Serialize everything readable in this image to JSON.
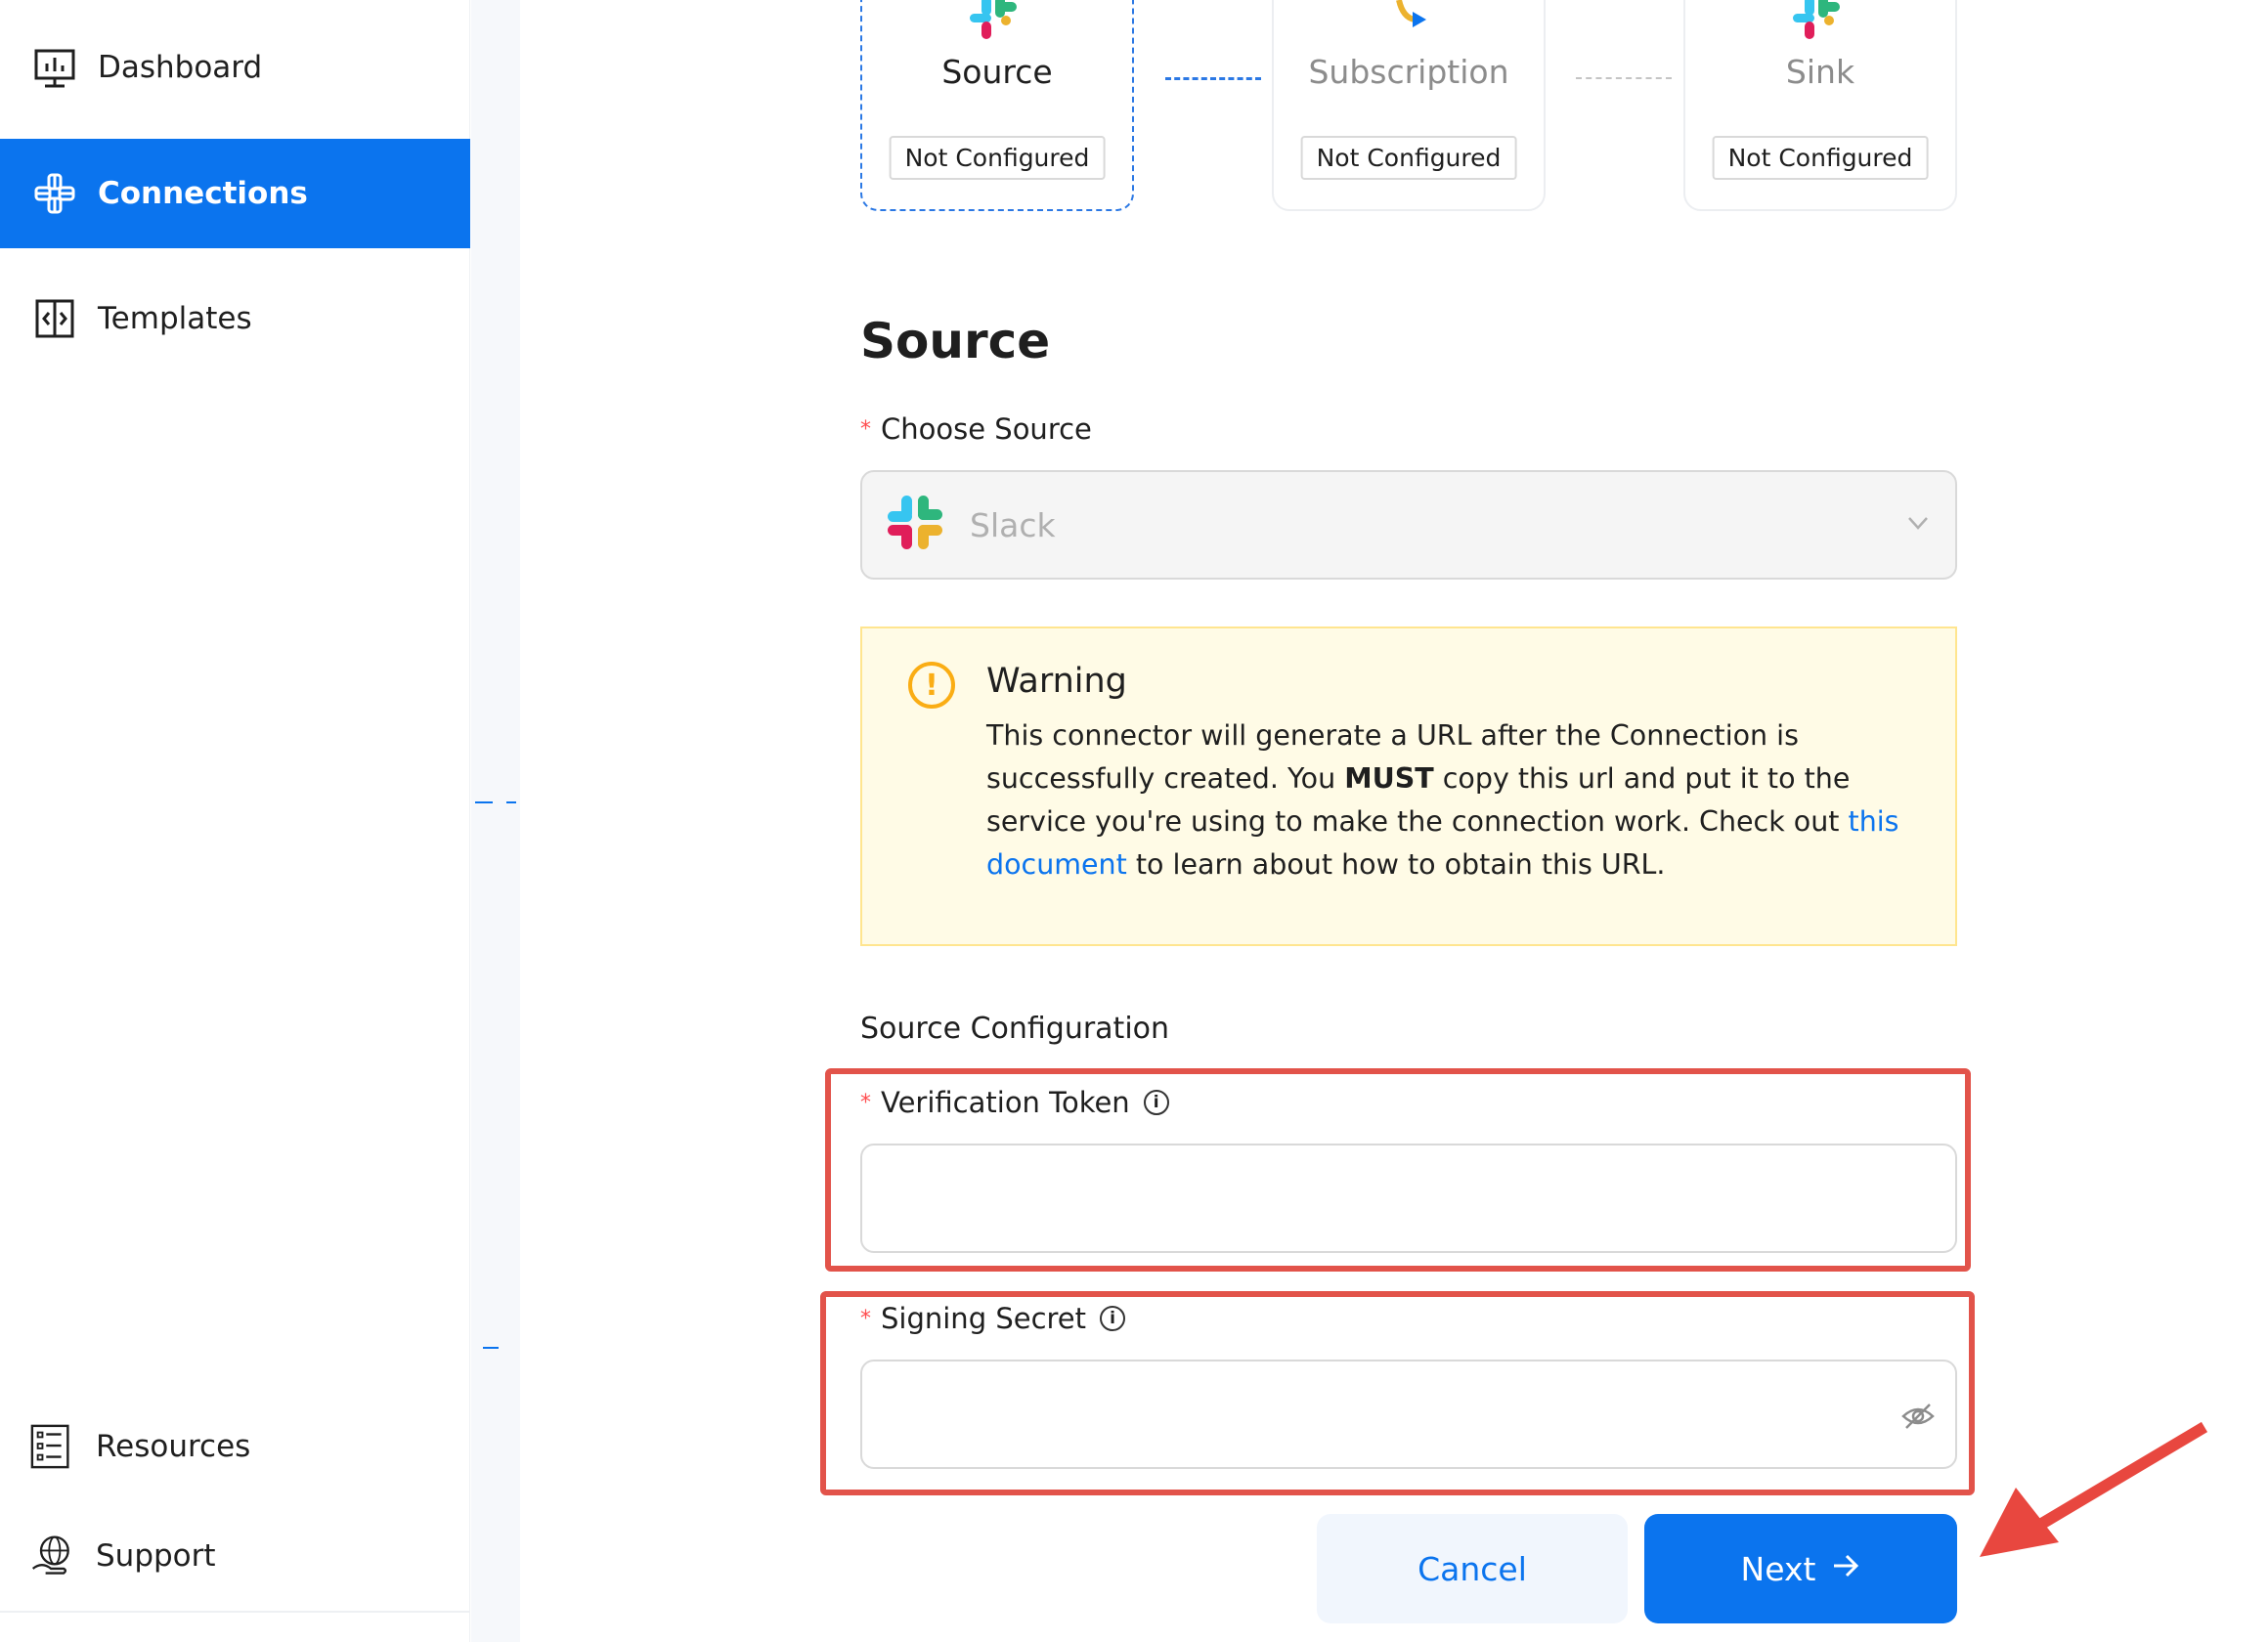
{
  "sidebar": {
    "items": [
      {
        "label": "Dashboard",
        "icon": "dashboard-icon"
      },
      {
        "label": "Connections",
        "icon": "connections-icon",
        "active": true
      },
      {
        "label": "Templates",
        "icon": "templates-icon"
      }
    ],
    "bottom_items": [
      {
        "label": "Resources",
        "icon": "resources-icon"
      },
      {
        "label": "Support",
        "icon": "support-icon"
      }
    ]
  },
  "stepper": {
    "steps": [
      {
        "title": "Source",
        "status": "Not Configured",
        "icon": "slack-icon"
      },
      {
        "title": "Subscription",
        "status": "Not Configured",
        "icon": "subscription-icon"
      },
      {
        "title": "Sink",
        "status": "Not Configured",
        "icon": "slack-icon"
      }
    ]
  },
  "form": {
    "section_title": "Source",
    "choose_source_label": "Choose Source",
    "selected_source": "Slack",
    "warning": {
      "title": "Warning",
      "body_1": "This connector will generate a URL after the Connection is successfully created. You ",
      "body_bold": "MUST",
      "body_2": " copy this url and put it to the service you're using to make the connection work. Check out ",
      "link_text": "this document",
      "body_3": " to learn about how to obtain this URL."
    },
    "config_title": "Source Configuration",
    "verification_token_label": "Verification Token",
    "signing_secret_label": "Signing Secret",
    "cancel_label": "Cancel",
    "next_label": "Next"
  },
  "colors": {
    "accent": "#0b74ee",
    "highlight": "#e2534a",
    "warning_bg": "#fffbe6",
    "warning_icon": "#faad14"
  }
}
